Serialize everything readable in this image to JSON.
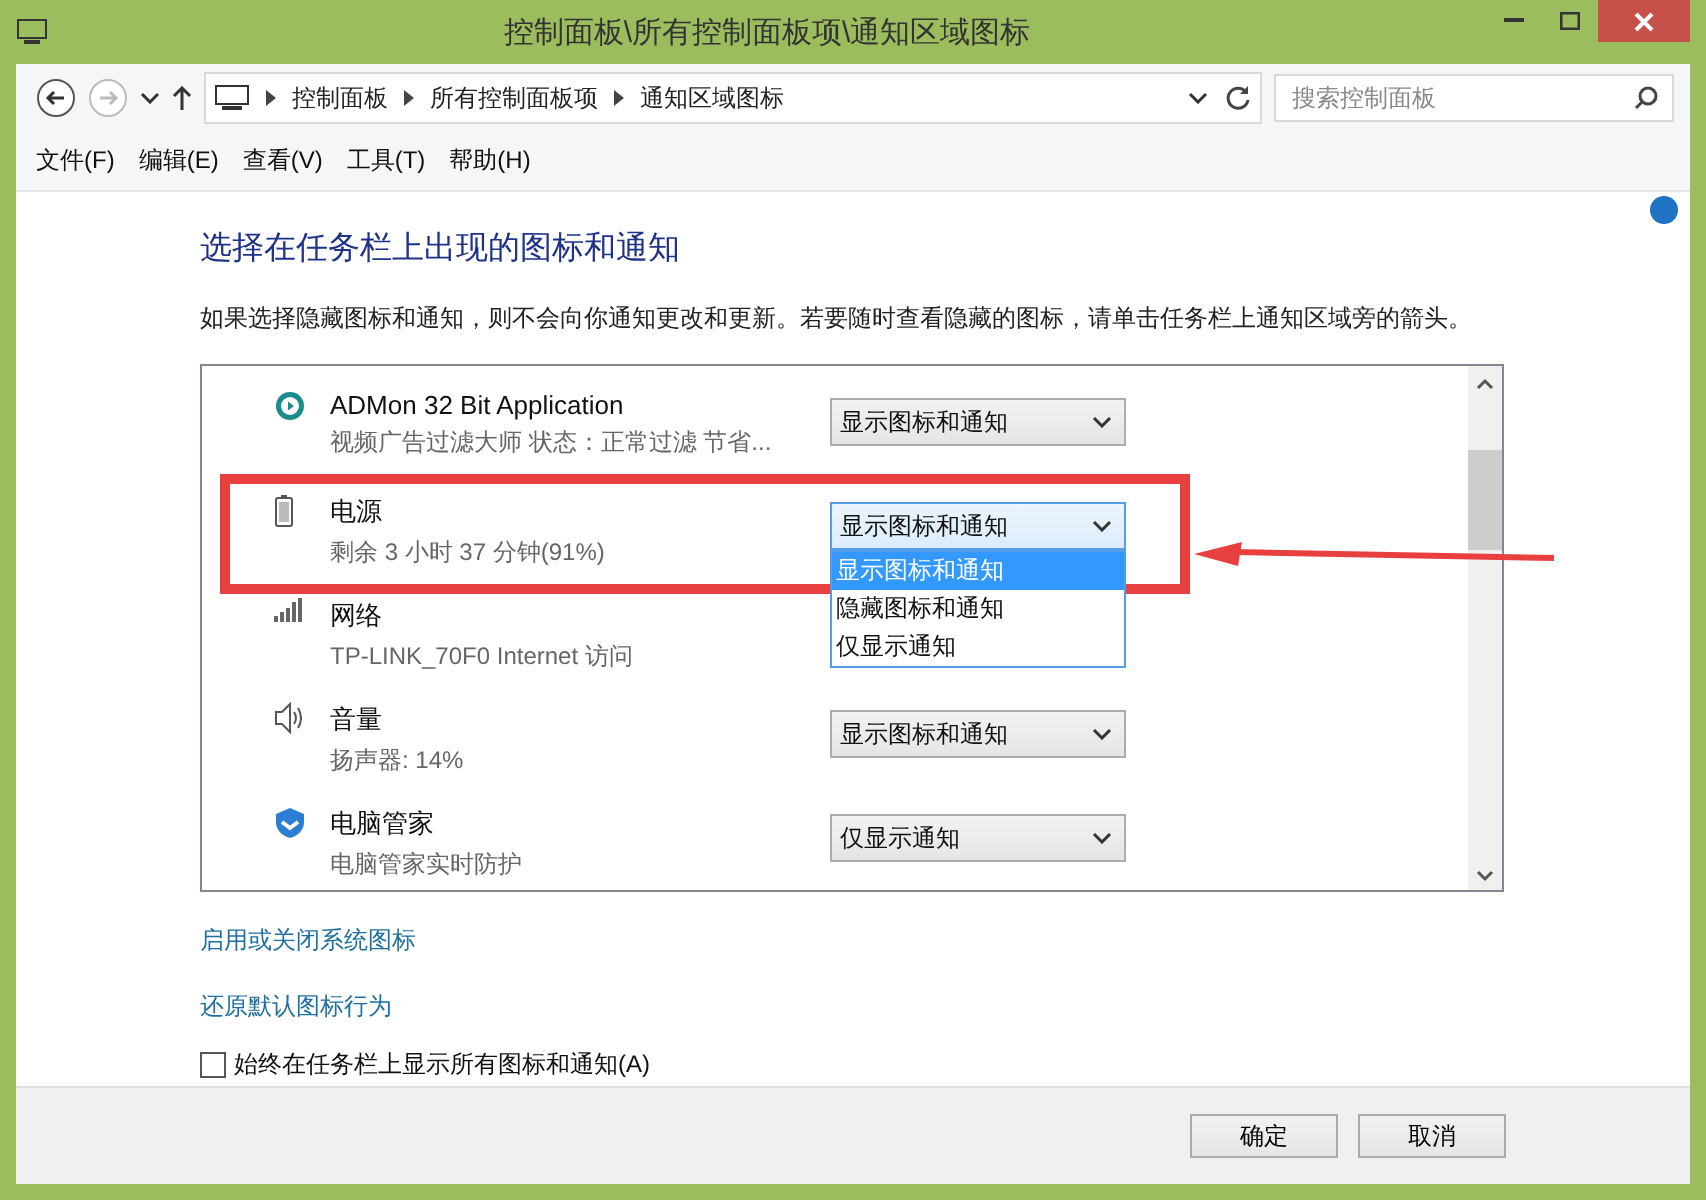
{
  "window": {
    "title": "控制面板\\所有控制面板项\\通知区域图标"
  },
  "address": {
    "crumbs": [
      "控制面板",
      "所有控制面板项",
      "通知区域图标"
    ]
  },
  "search": {
    "placeholder": "搜索控制面板"
  },
  "menu": [
    "文件(F)",
    "编辑(E)",
    "查看(V)",
    "工具(T)",
    "帮助(H)"
  ],
  "heading": "选择在任务栏上出现的图标和通知",
  "description": "如果选择隐藏图标和通知，则不会向你通知更改和更新。若要随时查看隐藏的图标，请单击任务栏上通知区域旁的箭头。",
  "rows": [
    {
      "name": "ADMon 32 Bit Application",
      "detail": "视频广告过滤大师  状态：正常过滤  节省...",
      "value": "显示图标和通知",
      "expanded": false,
      "highlighted": false
    },
    {
      "name": "电源",
      "detail": "剩余 3 小时 37 分钟(91%)",
      "value": "显示图标和通知",
      "expanded": true,
      "highlighted": true,
      "options": [
        {
          "label": "显示图标和通知",
          "selected": true
        },
        {
          "label": "隐藏图标和通知",
          "selected": false
        },
        {
          "label": "仅显示通知",
          "selected": false
        }
      ]
    },
    {
      "name": "网络",
      "detail": "TP-LINK_70F0 Internet 访问",
      "highlighted": false
    },
    {
      "name": "音量",
      "detail": "扬声器: 14%",
      "value": "显示图标和通知",
      "expanded": false,
      "highlighted": false
    },
    {
      "name": "电脑管家",
      "detail": "电脑管家实时防护",
      "value": "仅显示通知",
      "expanded": false,
      "highlighted": false
    }
  ],
  "links": [
    "启用或关闭系统图标",
    "还原默认图标行为"
  ],
  "always_show": {
    "label": "始终在任务栏上显示所有图标和通知(A)",
    "checked": false
  },
  "buttons": [
    "确定",
    "取消"
  ]
}
